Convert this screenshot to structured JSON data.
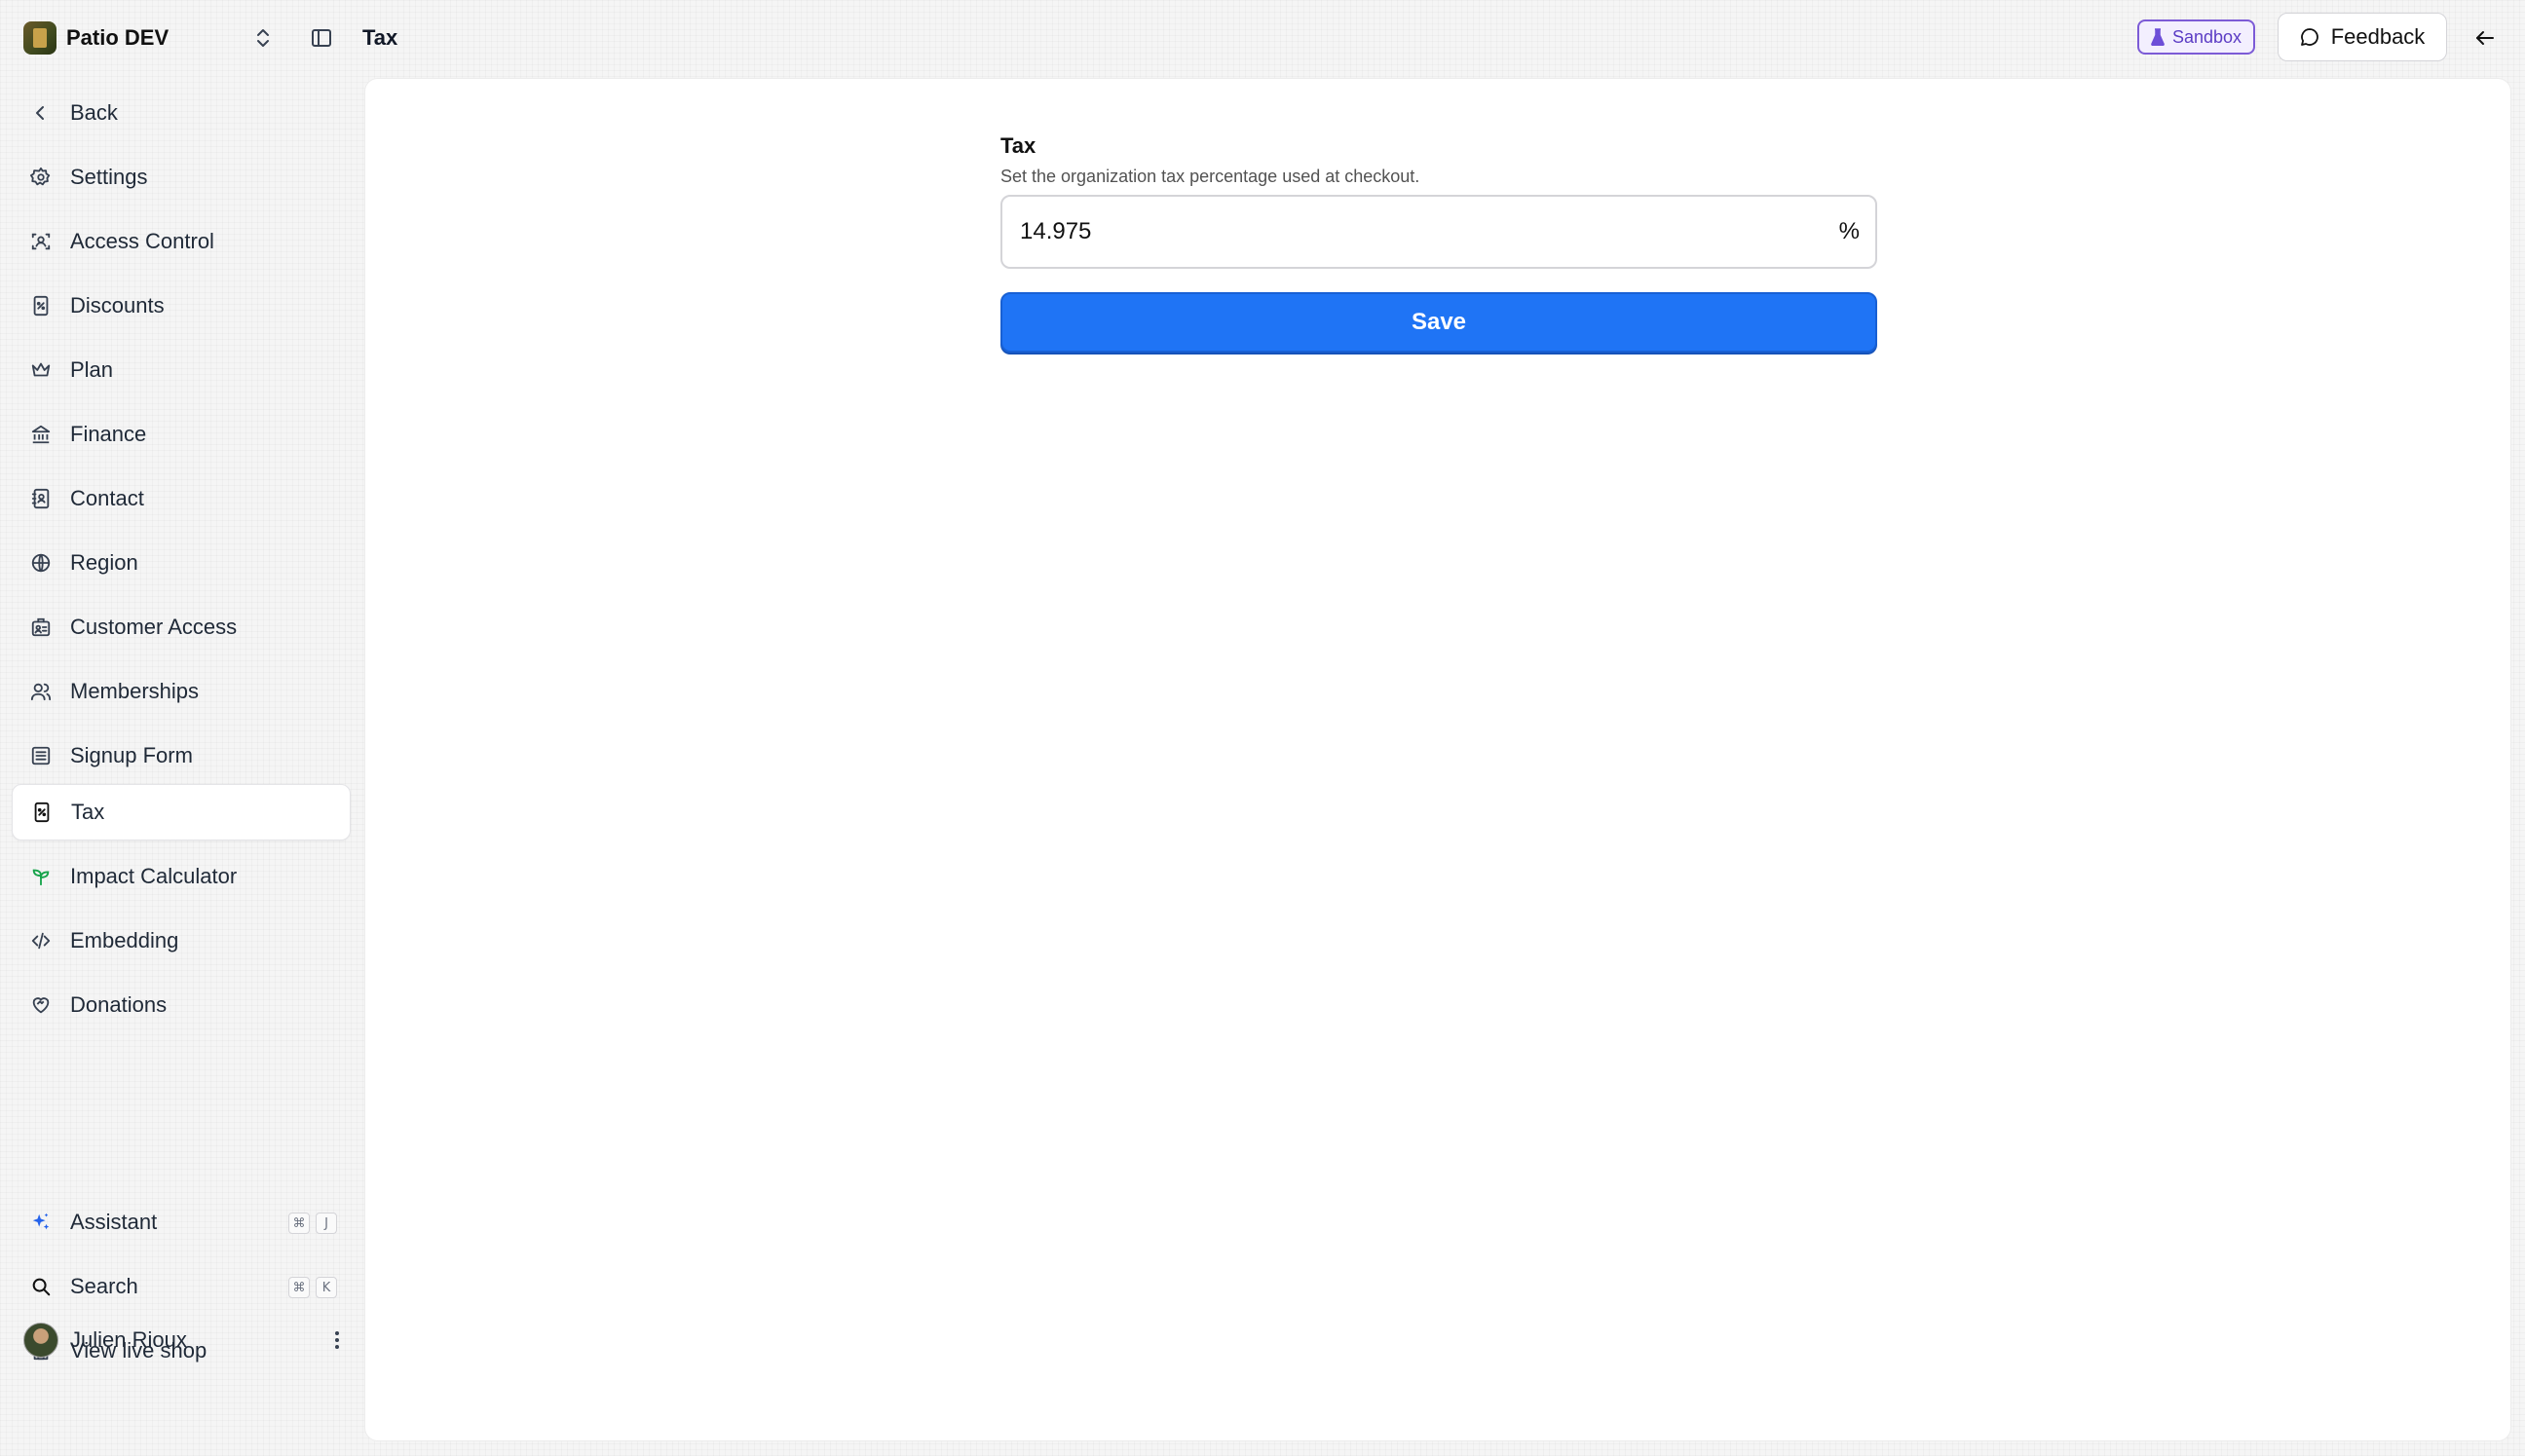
{
  "topbar": {
    "org_name": "Patio DEV",
    "page_title": "Tax",
    "sandbox_label": "Sandbox",
    "feedback_label": "Feedback"
  },
  "sidebar": {
    "back_label": "Back",
    "items": [
      {
        "label": "Settings",
        "icon": "gear-icon"
      },
      {
        "label": "Access Control",
        "icon": "user-scan-icon"
      },
      {
        "label": "Discounts",
        "icon": "receipt-percent-icon"
      },
      {
        "label": "Plan",
        "icon": "crown-icon"
      },
      {
        "label": "Finance",
        "icon": "bank-icon"
      },
      {
        "label": "Contact",
        "icon": "contact-book-icon"
      },
      {
        "label": "Region",
        "icon": "globe-icon"
      },
      {
        "label": "Customer Access",
        "icon": "id-card-icon"
      },
      {
        "label": "Memberships",
        "icon": "users-icon"
      },
      {
        "label": "Signup Form",
        "icon": "form-icon"
      },
      {
        "label": "Tax",
        "icon": "receipt-percent-icon",
        "active": true
      },
      {
        "label": "Impact Calculator",
        "icon": "sprout-icon"
      },
      {
        "label": "Embedding",
        "icon": "code-icon"
      },
      {
        "label": "Donations",
        "icon": "heart-handshake-icon"
      }
    ],
    "assistant_label": "Assistant",
    "assistant_shortcut": [
      "⌘",
      "J"
    ],
    "search_label": "Search",
    "search_shortcut": [
      "⌘",
      "K"
    ],
    "live_shop_label": "View live shop",
    "user_name": "Julien Rioux"
  },
  "form": {
    "label": "Tax",
    "help": "Set the organization tax percentage used at checkout.",
    "value": "14.975",
    "suffix": "%",
    "save_label": "Save"
  },
  "colors": {
    "accent": "#1f74f5",
    "sandbox": "#7c5bd6",
    "impact_icon": "#16a34a",
    "assistant_icon": "#2563eb"
  }
}
